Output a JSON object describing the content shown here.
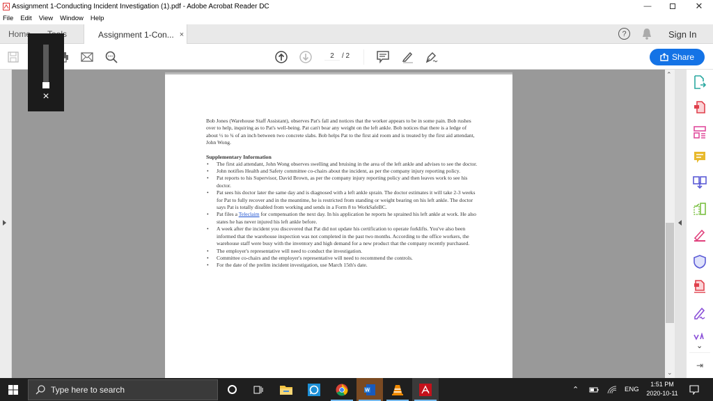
{
  "window": {
    "title": "Assignment 1-Conducting Incident Investigation (1).pdf - Adobe Acrobat Reader DC",
    "minimize_icon": "minimize-icon",
    "maximize_icon": "restore-icon",
    "close_icon": "close-icon"
  },
  "menu": [
    "File",
    "Edit",
    "View",
    "Window",
    "Help"
  ],
  "tabs": {
    "home": "Home",
    "tools": "Tools",
    "document": "Assignment 1-Con...",
    "close": "×"
  },
  "header_right": {
    "help_icon": "?",
    "sign_in": "Sign In"
  },
  "toolbar": {
    "page_current": "2",
    "page_total": "/ 2",
    "share_label": "Share"
  },
  "volume_overlay": {
    "level_percent": 0,
    "close": "×"
  },
  "document": {
    "paragraph": "Bob Jones (Warehouse Staff Assistant), observes Pat's fall and notices that the worker appears to be in some pain. Bob rushes over to help, inquiring as to Pat's well-being. Pat can't bear any weight on the left ankle. Bob notices that there is a ledge of about ½ to ¾ of an inch between two concrete slabs. Bob helps Pat to the first aid room and is treated by the first aid attendant, John Wong.",
    "heading": "Supplementary Information",
    "bullets": [
      "The first aid attendant, John Wong observes swelling and bruising in the area of the left ankle and advises to see the doctor.",
      "John notifies Health and Safety committee co-chairs about the incident, as per the company injury reporting policy.",
      "Pat reports to his Supervisor, David Brown, as per the company injury reporting policy and then leaves work to see his doctor.",
      "Pat sees his doctor later the same day and is diagnosed with a left ankle sprain. The doctor estimates it will take 2-3 weeks for Pat to fully recover and in the meantime, he is restricted from standing or weight bearing on his left ankle. The doctor says Pat is totally disabled from working and sends in a Form 8 to WorkSafeBC."
    ],
    "teleclaim_bullet": {
      "before": "Pat files a ",
      "link": "Teleclaim",
      "after": " for compensation the next day. In his application he reports he sprained his left ankle at work. He also states he has never injured his left ankle before."
    },
    "bullets_after": [
      "A week after the incident you discovered that Pat did not update his certification to operate forklifts. You've also been informed that the warehouse inspection was not completed in the past two months. According to the office workers, the warehouse staff were busy with the inventory and high demand for a new product that the company recently purchased.",
      "The employer's representative will need to conduct the investigation.",
      "Committee co-chairs and the employer's representative will need to recommend the controls.",
      "For the date of the prelim incident investigation, use March 15th's date."
    ]
  },
  "right_panel_tools": [
    "export-pdf",
    "create-pdf",
    "edit-pdf",
    "comment",
    "combine-files",
    "organize-pages",
    "fill-sign",
    "protect",
    "compress-pdf",
    "request-signature",
    "more-tools"
  ],
  "taskbar": {
    "search_placeholder": "Type here to search",
    "apps": [
      "cortana",
      "task-view",
      "file-explorer",
      "whatsapp",
      "chrome",
      "word",
      "vlc",
      "acrobat-reader"
    ],
    "language": "ENG",
    "time": "1:51 PM",
    "date": "2020-10-11"
  }
}
